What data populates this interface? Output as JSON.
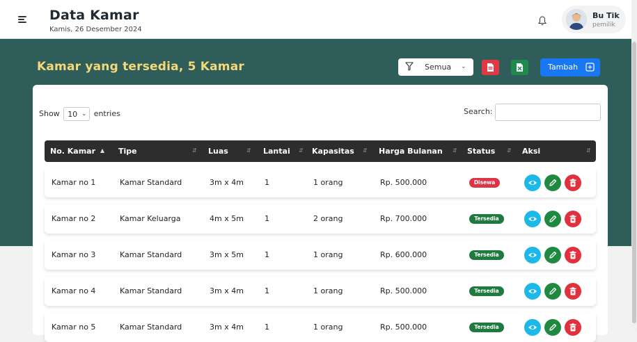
{
  "header": {
    "title": "Data Kamar",
    "date": "Kamis, 26 Desember 2024",
    "user": {
      "name": "Bu Tik",
      "role": "pemilik"
    }
  },
  "toolbar": {
    "heading": "Kamar yang tersedia, 5 Kamar",
    "filter_value": "Semua",
    "add_label": "Tambah"
  },
  "table_controls": {
    "show_label": "Show",
    "entries_value": "10",
    "entries_label": "entries",
    "search_label": "Search:",
    "search_value": ""
  },
  "table": {
    "columns": [
      "No. Kamar",
      "Tipe",
      "Luas",
      "Lantai",
      "Kapasitas",
      "Harga Bulanan",
      "Status",
      "Aksi"
    ],
    "rows": [
      {
        "no": "Kamar no 1",
        "tipe": "Kamar Standard",
        "luas": "3m x 4m",
        "lantai": "1",
        "kapasitas": "1 orang",
        "harga": "Rp. 500.000",
        "status": "Disewa"
      },
      {
        "no": "Kamar no 2",
        "tipe": "Kamar Keluarga",
        "luas": "4m x 5m",
        "lantai": "1",
        "kapasitas": "2 orang",
        "harga": "Rp. 700.000",
        "status": "Tersedia"
      },
      {
        "no": "Kamar no 3",
        "tipe": "Kamar Standard",
        "luas": "3m x 5m",
        "lantai": "1",
        "kapasitas": "1 orang",
        "harga": "Rp. 600.000",
        "status": "Tersedia"
      },
      {
        "no": "Kamar no 4",
        "tipe": "Kamar Standard",
        "luas": "3m x 4m",
        "lantai": "1",
        "kapasitas": "1 orang",
        "harga": "Rp. 500.000",
        "status": "Tersedia"
      },
      {
        "no": "Kamar no 5",
        "tipe": "Kamar Standard",
        "luas": "3m x 4m",
        "lantai": "1",
        "kapasitas": "1 orang",
        "harga": "Rp. 500.000",
        "status": "Tersedia"
      }
    ]
  },
  "colors": {
    "header_bg": "#2f5d59",
    "heading": "#f4d87a",
    "disewa": "#dc3545",
    "tersedia": "#1f7a3f",
    "view": "#1bb8e8",
    "edit": "#1f8a3f",
    "delete": "#e0313c",
    "add": "#1877f2"
  },
  "icons": {
    "menu": "hamburger-icon",
    "notification": "bell-icon",
    "filter": "filter-icon",
    "pdf": "file-pdf-icon",
    "excel": "file-excel-icon",
    "add": "plus-square-icon",
    "view": "eye-icon",
    "edit": "pencil-icon",
    "delete": "trash-icon"
  }
}
